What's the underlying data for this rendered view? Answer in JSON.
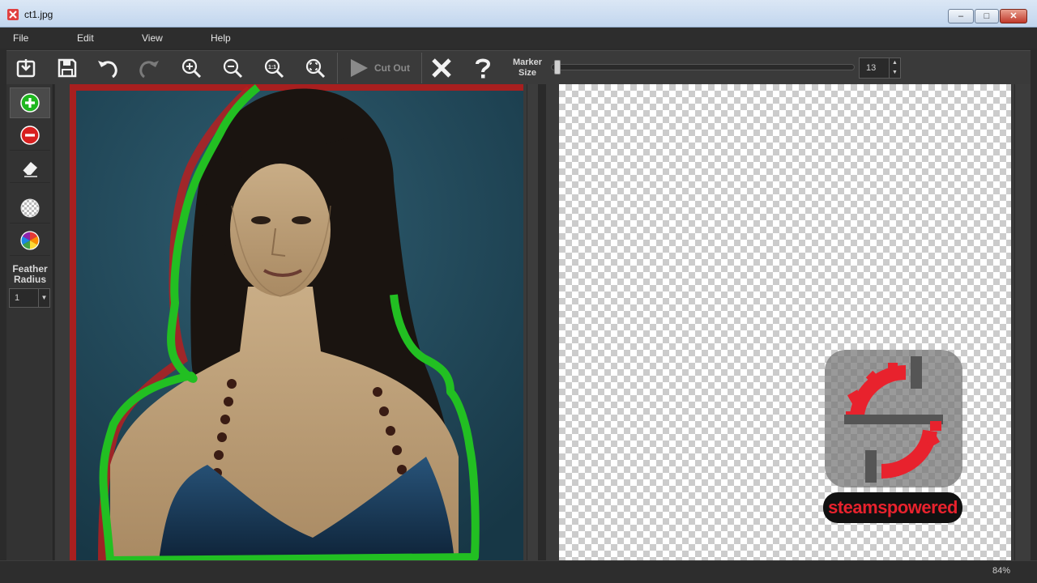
{
  "window": {
    "title": "ct1.jpg",
    "minimize": "–",
    "maximize": "□",
    "close": "✕"
  },
  "menu": [
    {
      "label": "File"
    },
    {
      "label": "Edit"
    },
    {
      "label": "View"
    },
    {
      "label": "Help"
    }
  ],
  "toolbar": {
    "buttons": [
      {
        "name": "open-icon",
        "label": ""
      },
      {
        "name": "save-icon",
        "label": ""
      },
      {
        "name": "undo-icon",
        "label": ""
      },
      {
        "name": "redo-icon",
        "label": ""
      },
      {
        "name": "zoom-in-icon",
        "label": ""
      },
      {
        "name": "zoom-out-icon",
        "label": ""
      },
      {
        "name": "zoom-actual-icon",
        "label": ""
      },
      {
        "name": "zoom-fit-icon",
        "label": ""
      }
    ],
    "cut_out_label": "Cut Out",
    "clear_icon": "close-x-icon",
    "help_icon": "help-icon",
    "marker_label_line1": "Marker",
    "marker_label_line2": "Size",
    "marker_size_value": "13"
  },
  "left_tools": {
    "tools": [
      {
        "name": "add-marker-icon"
      },
      {
        "name": "remove-marker-icon"
      },
      {
        "name": "eraser-icon"
      },
      {
        "name": "transparent-bg-icon"
      },
      {
        "name": "color-bg-icon"
      }
    ],
    "feather_label_line1": "Feather",
    "feather_label_line2": "Radius",
    "feather_value": "1"
  },
  "watermark": {
    "text": "steamspowered"
  },
  "status": {
    "zoom": "84%"
  },
  "colors": {
    "accent_green": "#2dbd2d",
    "accent_red": "#d32b2b",
    "photo_bg": "#1f4a5e"
  }
}
